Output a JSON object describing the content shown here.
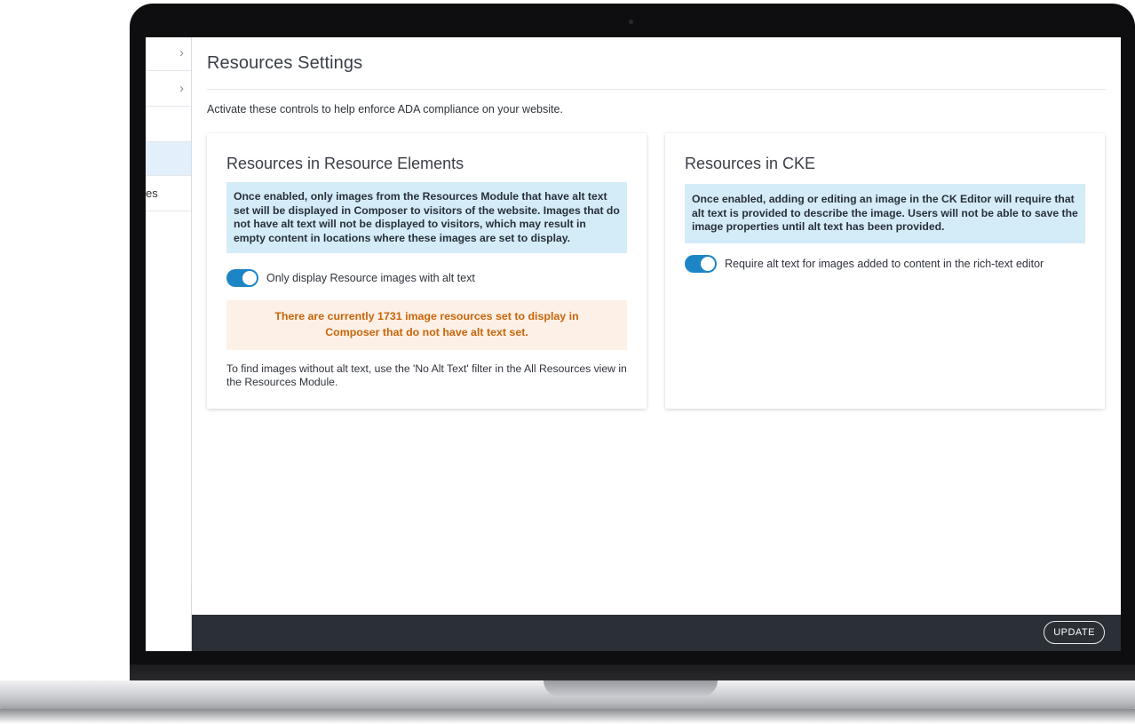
{
  "page": {
    "title": "Resources Settings",
    "intro": "Activate these controls to help enforce ADA compliance on your website."
  },
  "sidebar": {
    "items": [
      {
        "label": "",
        "chevron": "›"
      },
      {
        "label": "",
        "chevron": "›"
      },
      {
        "label": ""
      },
      {
        "label": "",
        "active": true
      },
      {
        "label": "es"
      }
    ]
  },
  "cards": {
    "resource_elements": {
      "title": "Resources in Resource Elements",
      "info": "Once enabled, only images from the Resources Module that have alt text set will be displayed in Composer to visitors of the website. Images that do not have alt text will not be displayed to visitors, which may result in empty content in locations where these images are set to display.",
      "toggle_label": "Only display Resource images with alt text",
      "toggle_on": true,
      "warning": "There are currently 1731 image resources set to display in Composer that do not have alt text set.",
      "help": "To find images without alt text, use the 'No Alt Text' filter in the All Resources view in the Resources Module."
    },
    "cke": {
      "title": "Resources in CKE",
      "info": "Once enabled, adding or editing an image in the CK Editor will require that alt text is provided to describe the image. Users will not be able to save the image properties until alt text has been provided.",
      "toggle_label": "Require alt text for images added to content in the rich-text editor",
      "toggle_on": true
    }
  },
  "footer": {
    "update_label": "UPDATE"
  },
  "colors": {
    "accent": "#1d85c6",
    "info_bg": "#d4ecf7",
    "warning_bg": "#fdf0e6",
    "warning_text": "#c7650b",
    "footer_bg": "#2b2f36"
  }
}
